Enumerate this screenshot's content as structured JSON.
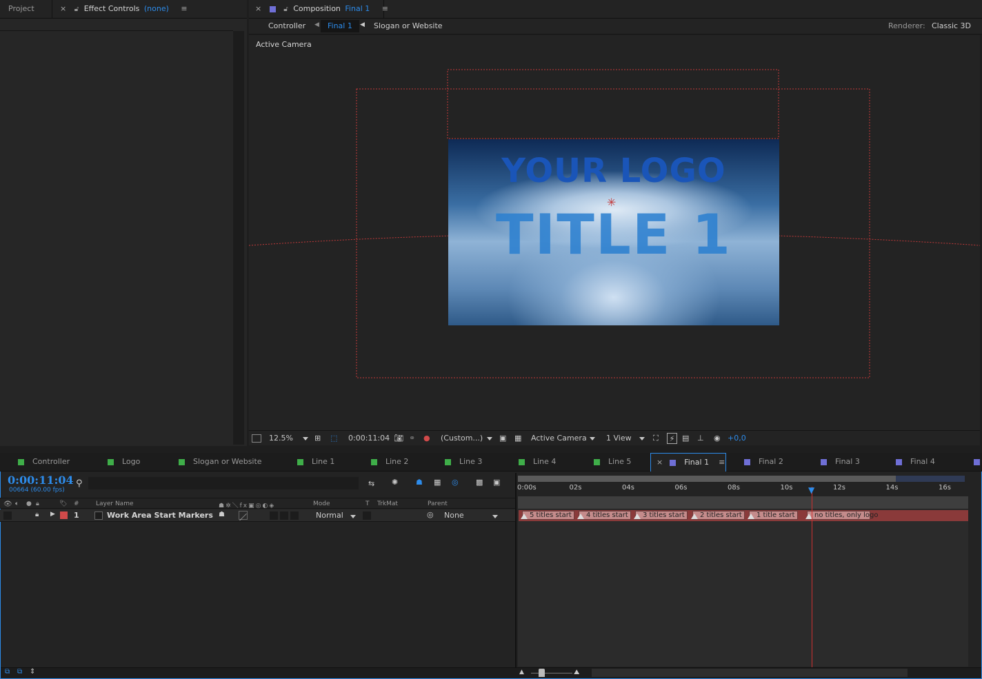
{
  "top_left_tabs": {
    "project": "Project",
    "effect_controls": "Effect Controls",
    "effect_controls_target": "(none)"
  },
  "composition_tab": {
    "label": "Composition",
    "name": "Final 1"
  },
  "comp_nav": {
    "items": [
      "Controller",
      "Final 1",
      "Slogan or Website"
    ],
    "renderer_label": "Renderer:",
    "renderer_value": "Classic 3D"
  },
  "viewer": {
    "view_label": "Active Camera",
    "logo_text": "YOUR LOGO",
    "title_text": "TITLE 1"
  },
  "viewer_toolbar": {
    "zoom": "12.5%",
    "timecode": "0:00:11:04",
    "resolution": "(Custom...)",
    "camera": "Active Camera",
    "views": "1 View",
    "exposure": "+0,0"
  },
  "timeline_tabs": [
    {
      "label": "Controller",
      "color": "#3fae49"
    },
    {
      "label": "Logo",
      "color": "#3fae49"
    },
    {
      "label": "Slogan or Website",
      "color": "#3fae49"
    },
    {
      "label": "Line 1",
      "color": "#3fae49"
    },
    {
      "label": "Line 2",
      "color": "#3fae49"
    },
    {
      "label": "Line 3",
      "color": "#3fae49"
    },
    {
      "label": "Line 4",
      "color": "#3fae49"
    },
    {
      "label": "Line 5",
      "color": "#3fae49"
    },
    {
      "label": "Final 1",
      "color": "#6f6fd6"
    },
    {
      "label": "Final 2",
      "color": "#6f6fd6"
    },
    {
      "label": "Final 3",
      "color": "#6f6fd6"
    },
    {
      "label": "Final 4",
      "color": "#6f6fd6"
    }
  ],
  "timeline": {
    "current_time": "0:00:11:04",
    "frame_info": "00664 (60.00 fps)",
    "search_placeholder": "",
    "columns": {
      "num": "#",
      "layer_name": "Layer Name",
      "mode": "Mode",
      "t": "T",
      "trkmat": "TrkMat",
      "parent": "Parent"
    },
    "layer": {
      "index": "1",
      "name": "Work Area Start Markers",
      "mode": "Normal",
      "parent": "None",
      "label_color": "#d14a4a"
    },
    "ruler_ticks": [
      "0:00s",
      "02s",
      "04s",
      "06s",
      "08s",
      "10s",
      "12s",
      "14s",
      "16s"
    ],
    "markers": [
      "5 titles start",
      "4 titles start",
      "3 titles start",
      "2 titles start",
      "1 title start",
      "no titles, only logo"
    ]
  },
  "colors": {
    "accent": "#2d8ceb",
    "guide_red": "#c43a3a",
    "layer_bar": "#8a3a3a",
    "playhead": "#2d8ceb"
  }
}
